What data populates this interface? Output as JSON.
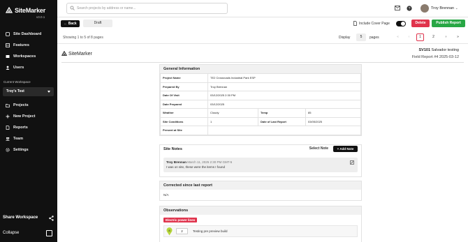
{
  "app": {
    "name": "SiteMarker",
    "version": "v3.0.1"
  },
  "sidebar": {
    "items_top": [
      {
        "label": "Site Dashboard",
        "icon": "dashboard-icon"
      },
      {
        "label": "Features",
        "icon": "features-icon"
      },
      {
        "label": "Workspaces",
        "icon": "workspaces-icon"
      },
      {
        "label": "Users",
        "icon": "users-icon"
      }
    ],
    "current_workspace_label": "Current Workspace",
    "current_workspace": "Troy's Test",
    "items_bottom": [
      {
        "label": "Projects",
        "icon": "projects-icon"
      },
      {
        "label": "New Project",
        "icon": "plus-icon"
      },
      {
        "label": "Reports",
        "icon": "reports-icon"
      },
      {
        "label": "Team",
        "icon": "team-icon"
      },
      {
        "label": "Settings",
        "icon": "gear-icon"
      }
    ],
    "share_label": "Share Workspace",
    "collapse_label": "Collapse"
  },
  "header": {
    "search_placeholder": "Search projects by address or name...",
    "user_name": "Troy Brennan"
  },
  "actions": {
    "back_label": "Back",
    "status_label": "Draft",
    "include_cover_label": "Include Cover Page",
    "include_cover_on": true,
    "delete_label": "Delete",
    "publish_label": "Publish Report"
  },
  "pagination": {
    "showing_prefix": "Showing of",
    "showing_from": "1",
    "showing_to": "5",
    "showing_total": "8",
    "showing_suffix": "pages",
    "display_label": "Display",
    "display_value": "5",
    "pages_label": "pages",
    "pages": [
      "1",
      "2"
    ],
    "current_page": "1"
  },
  "report": {
    "logo_text": "SiteMarker",
    "site_code": "SV101",
    "site_name": "Salvador testing",
    "report_label": "Field Report #4 2025-03-12",
    "general_info": {
      "title": "General Information",
      "rows": [
        {
          "label": "Project Name",
          "value": "TE2 Crossroads Industrial Park ESP"
        },
        {
          "label": "Prepared By",
          "value": "Troy Brennan"
        },
        {
          "label": "Date Of Visit",
          "value": "03/12/2025 2:30 PM"
        },
        {
          "label": "Date Prepared",
          "value": "03/12/2025"
        }
      ],
      "weather_label": "Weather",
      "weather_value": "Cloudy",
      "temp_label": "Temp",
      "temp_value": "85",
      "site_conditions_label": "Site Conditions",
      "site_conditions_value": "1",
      "last_report_label": "Date of Last Report",
      "last_report_value": "03/05/2025",
      "present_label": "Present at Site",
      "present_value": ""
    },
    "site_notes": {
      "title": "Site Notes",
      "select_label": "Select Note",
      "add_label": "Add Note",
      "notes": [
        {
          "author": "Troy Brennan",
          "meta": "March 11, 2025 2:30 PM GMT-5",
          "body": "I was on site, these were the items I found"
        }
      ]
    },
    "corrected": {
      "title": "Corrected since last report",
      "value": "N/A"
    },
    "observations": {
      "title": "Observations",
      "tag": "Electric power lines",
      "tag_color": "#e0334c",
      "items": [
        {
          "pin": "8",
          "number": "2",
          "text": "Testing pre preview build"
        }
      ]
    }
  },
  "colors": {
    "sidebar_bg": "#111111",
    "accent_red": "#e0334c",
    "accent_green": "#28a745"
  }
}
